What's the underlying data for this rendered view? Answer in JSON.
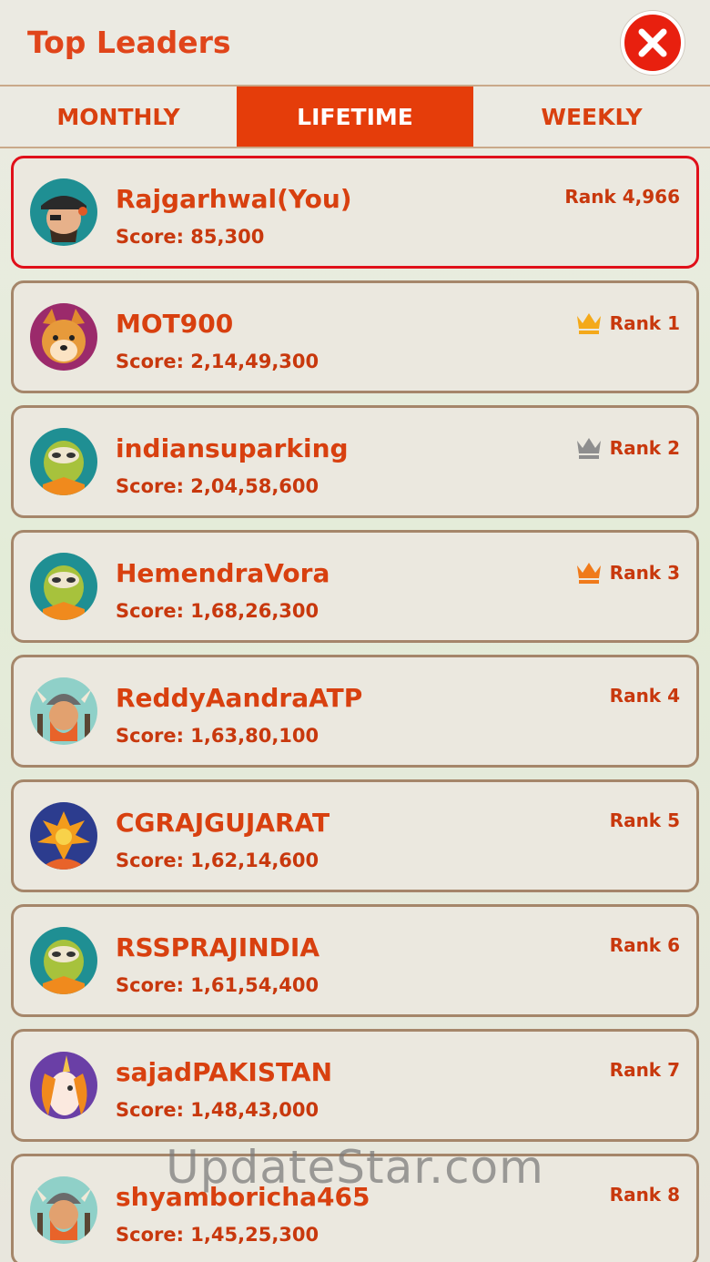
{
  "header": {
    "title": "Top Leaders"
  },
  "tabs": [
    {
      "label": "MONTHLY",
      "active": false
    },
    {
      "label": "LIFETIME",
      "active": true
    },
    {
      "label": "WEEKLY",
      "active": false
    }
  ],
  "colors": {
    "accent": "#e53d0a",
    "text": "#d8400f",
    "card_border": "#a5866a",
    "self_border": "#e0101a",
    "gold_crown": "#f4a91a",
    "silver_crown": "#8e8e8e",
    "bronze_crown": "#f07a1a"
  },
  "rows": [
    {
      "name": "Rajgarhwal(You)",
      "score": "Score: 85,300",
      "rank": "Rank 4,966",
      "avatar": "pirate-avatar",
      "crown": ""
    },
    {
      "name": "MOT900",
      "score": "Score: 2,14,49,300",
      "rank": "Rank 1",
      "avatar": "dog-avatar",
      "crown": "gold"
    },
    {
      "name": "indiansuparking",
      "score": "Score: 2,04,58,600",
      "rank": "Rank 2",
      "avatar": "sloth-avatar",
      "crown": "silver"
    },
    {
      "name": "HemendraVora",
      "score": "Score: 1,68,26,300",
      "rank": "Rank 3",
      "avatar": "sloth-avatar",
      "crown": "bronze"
    },
    {
      "name": "ReddyAandraATP",
      "score": "Score: 1,63,80,100",
      "rank": "Rank 4",
      "avatar": "viking-avatar",
      "crown": ""
    },
    {
      "name": "CGRAJGUJARAT",
      "score": "Score: 1,62,14,600",
      "rank": "Rank 5",
      "avatar": "phoenix-avatar",
      "crown": ""
    },
    {
      "name": "RSSPRAJINDIA",
      "score": "Score: 1,61,54,400",
      "rank": "Rank 6",
      "avatar": "sloth-avatar",
      "crown": ""
    },
    {
      "name": "sajadPAKISTAN",
      "score": "Score: 1,48,43,000",
      "rank": "Rank 7",
      "avatar": "unicorn-avatar",
      "crown": ""
    },
    {
      "name": "shyamboricha465",
      "score": "Score: 1,45,25,300",
      "rank": "Rank 8",
      "avatar": "viking-avatar",
      "crown": ""
    }
  ],
  "watermark": "UpdateStar.com"
}
